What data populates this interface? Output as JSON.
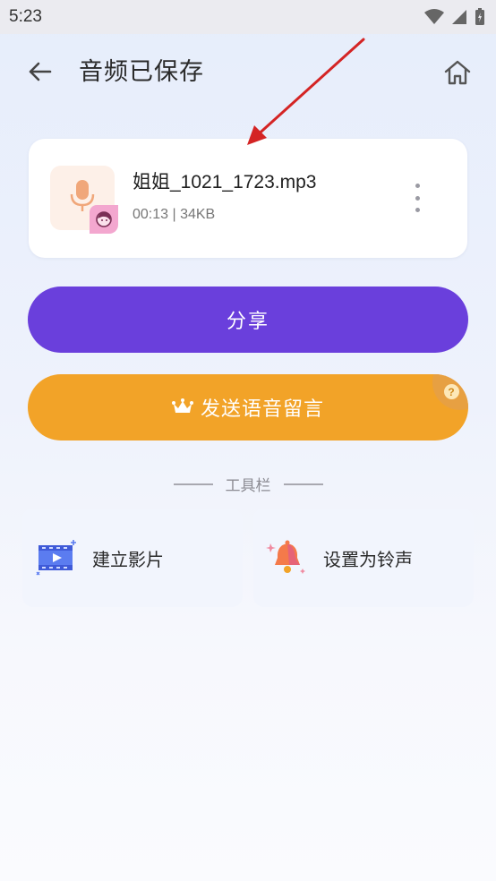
{
  "status_bar": {
    "time": "5:23"
  },
  "header": {
    "title": "音频已保存"
  },
  "file": {
    "name": "姐姐_1021_1723.mp3",
    "meta": "00:13 | 34KB"
  },
  "actions": {
    "share_label": "分享",
    "voicemail_label": "发送语音留言",
    "help_glyph": "?"
  },
  "toolbar": {
    "title": "工具栏",
    "items": [
      {
        "label": "建立影片",
        "icon": "video-icon"
      },
      {
        "label": "设置为铃声",
        "icon": "bell-icon"
      }
    ]
  },
  "colors": {
    "primary": "#6a3fdc",
    "accent": "#f2a328",
    "annotation_arrow": "#d42424"
  }
}
